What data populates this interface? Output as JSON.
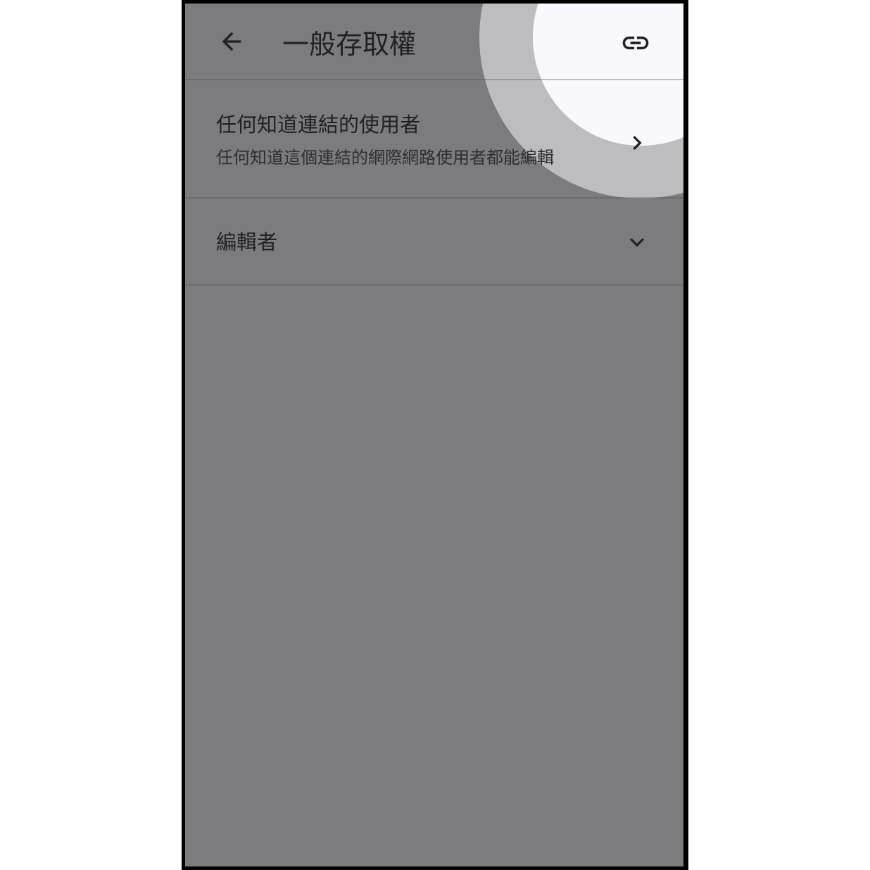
{
  "header": {
    "title": "一般存取權",
    "back_icon": "arrow-back-icon",
    "link_icon": "link-icon"
  },
  "access_row": {
    "primary": "任何知道連結的使用者",
    "secondary": "任何知道這個連結的網際網路使用者都能編輯",
    "icon": "chevron-right-icon"
  },
  "role_row": {
    "label": "編輯者",
    "icon": "chevron-down-icon"
  },
  "colors": {
    "scrim": "#7c7c7e",
    "spotlight_ring": "#bdbdbf",
    "spotlight_center": "#f9f8fd",
    "text": "#202124"
  }
}
